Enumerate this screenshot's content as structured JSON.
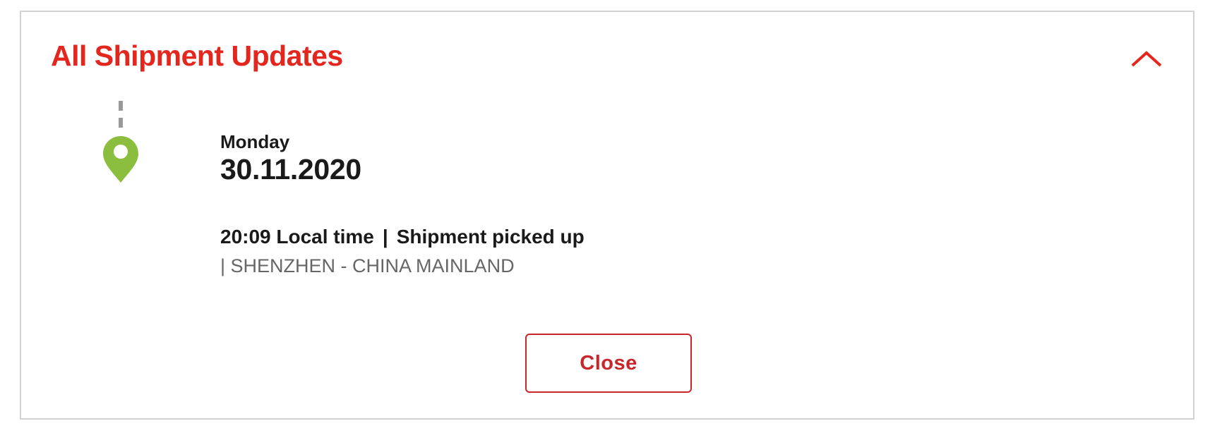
{
  "panel": {
    "title": "All Shipment Updates",
    "toggle_icon": "chevron-up-icon"
  },
  "colors": {
    "accent_red": "#e3271f",
    "button_red": "#c8262b",
    "pin_green": "#8bbd3f",
    "timeline_gray": "#9a9a9a",
    "location_gray": "#666666"
  },
  "events": [
    {
      "weekday": "Monday",
      "date": "30.11.2020",
      "time": "20:09 Local time",
      "separator": "|",
      "status": "Shipment picked up",
      "location": "| SHENZHEN - CHINA MAINLAND",
      "icon": "location-pin-icon"
    }
  ],
  "actions": {
    "close_label": "Close"
  }
}
